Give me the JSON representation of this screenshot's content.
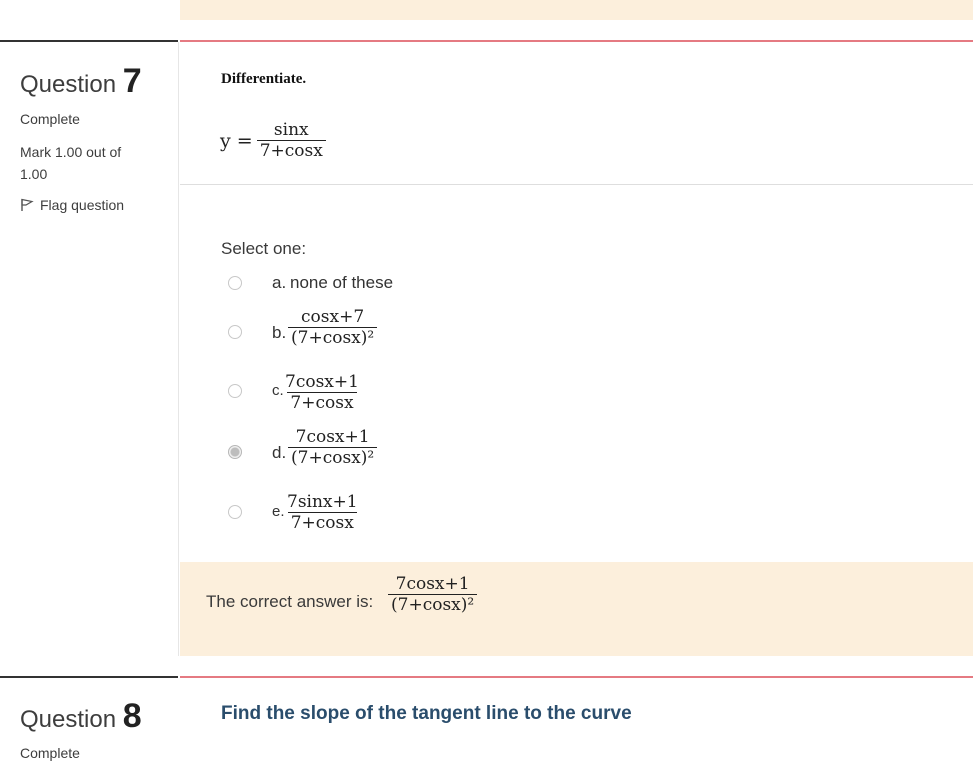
{
  "question7": {
    "label": "Question",
    "number": "7",
    "state": "Complete",
    "mark": "Mark 1.00 out of",
    "mark_max": "1.00",
    "flag": "Flag question",
    "prompt": "Differentiate.",
    "function_lhs": "y =",
    "function_num": "sinx",
    "function_den": "7+cosx",
    "select_one": "Select one:",
    "options": [
      {
        "letter": "a.",
        "text": "none of these",
        "selected": false
      },
      {
        "letter": "b.",
        "num": "cosx+7",
        "den": "(7+cosx)²",
        "selected": false
      },
      {
        "letter": "c.",
        "num": "7cosx+1",
        "den": "7+cosx",
        "selected": false
      },
      {
        "letter": "d.",
        "num": "7cosx+1",
        "den": "(7+cosx)²",
        "selected": true
      },
      {
        "letter": "e.",
        "num": "7sinx+1",
        "den": "7+cosx",
        "selected": false
      }
    ],
    "correct_label": "The correct answer is:",
    "correct_num": "7cosx+1",
    "correct_den": "(7+cosx)²"
  },
  "question8": {
    "label": "Question",
    "number": "8",
    "state": "Complete",
    "prompt": "Find the slope of the tangent line to the curve"
  }
}
